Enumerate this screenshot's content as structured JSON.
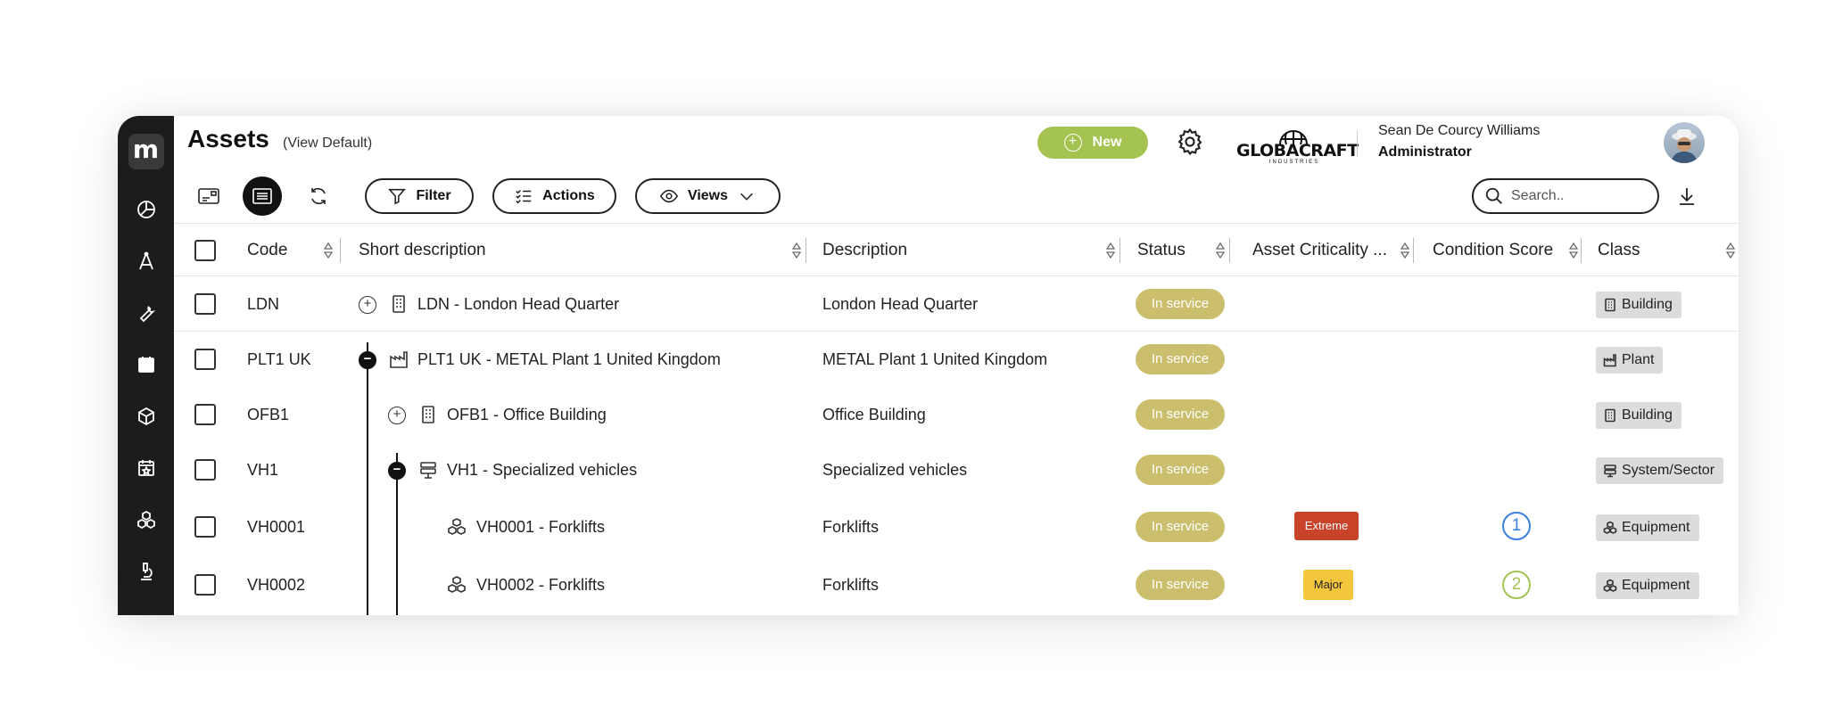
{
  "header": {
    "title": "Assets",
    "view": "(View Default)",
    "new_label": "New",
    "brand_name": "GLOBACRAFT",
    "brand_sub": "INDUSTRIES",
    "user_name": "Sean De Courcy Williams",
    "user_role": "Administrator"
  },
  "toolbar": {
    "filter_label": "Filter",
    "actions_label": "Actions",
    "views_label": "Views",
    "search_placeholder": "Search.."
  },
  "table": {
    "columns": {
      "code": "Code",
      "short_description": "Short description",
      "description": "Description",
      "status": "Status",
      "criticality": "Asset Criticality ...",
      "condition": "Condition Score",
      "class": "Class"
    },
    "rows": [
      {
        "code": "LDN",
        "short": "LDN - London Head Quarter",
        "description": "London Head Quarter",
        "status": "In service",
        "criticality": "",
        "score": "",
        "class": "Building",
        "icon": "building-icon"
      },
      {
        "code": "PLT1 UK",
        "short": "PLT1 UK - METAL Plant 1 United Kingdom",
        "description": "METAL Plant 1 United Kingdom",
        "status": "In service",
        "criticality": "",
        "score": "",
        "class": "Plant",
        "icon": "factory-icon"
      },
      {
        "code": "OFB1",
        "short": "OFB1 - Office Building",
        "description": "Office Building",
        "status": "In service",
        "criticality": "",
        "score": "",
        "class": "Building",
        "icon": "building-icon"
      },
      {
        "code": "VH1",
        "short": "VH1 - Specialized vehicles",
        "description": "Specialized vehicles",
        "status": "In service",
        "criticality": "",
        "score": "",
        "class": "System/Sector",
        "icon": "system-icon"
      },
      {
        "code": "VH0001",
        "short": "VH0001 - Forklifts",
        "description": "Forklifts",
        "status": "In service",
        "criticality": "Extreme",
        "score": "1",
        "class": "Equipment",
        "icon": "equipment-icon"
      },
      {
        "code": "VH0002",
        "short": "VH0002 - Forklifts",
        "description": "Forklifts",
        "status": "In service",
        "criticality": "Major",
        "score": "2",
        "class": "Equipment",
        "icon": "equipment-icon"
      }
    ]
  },
  "colors": {
    "accent": "#a4c351",
    "status": "#cbbf6d",
    "extreme": "#c9432a",
    "major": "#f3c63b",
    "score1": "#3b7fe0",
    "score2": "#a4c351",
    "sidebar": "#1c1c1c"
  }
}
